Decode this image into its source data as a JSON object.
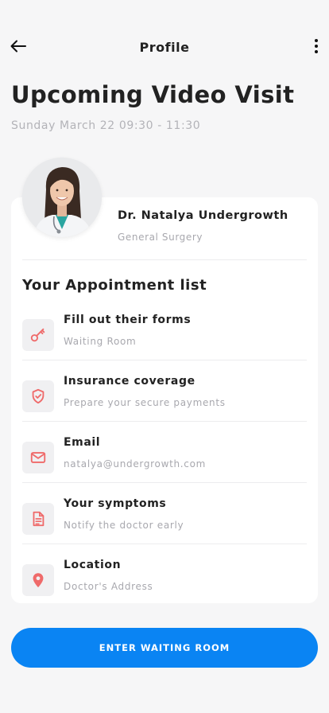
{
  "header": {
    "title": "Profile",
    "back_icon": "arrow-left-icon",
    "menu_icon": "more-vertical-icon"
  },
  "visit": {
    "title": "Upcoming Video Visit",
    "datetime": "Sunday March 22 09:30 - 11:30"
  },
  "doctor": {
    "name": "Dr. Natalya Undergrowth",
    "specialty": "General Surgery"
  },
  "appointment": {
    "section_title": "Your Appointment list",
    "items": [
      {
        "icon": "key-icon",
        "title": "Fill out their forms",
        "subtitle": "Waiting Room"
      },
      {
        "icon": "shield-check-icon",
        "title": "Insurance coverage",
        "subtitle": "Prepare your secure payments"
      },
      {
        "icon": "mail-icon",
        "title": "Email",
        "subtitle": "natalya@undergrowth.com"
      },
      {
        "icon": "document-icon",
        "title": "Your symptoms",
        "subtitle": "Notify the doctor early"
      },
      {
        "icon": "location-pin-icon",
        "title": "Location",
        "subtitle": "Doctor's Address"
      }
    ]
  },
  "cta": {
    "label": "ENTER WAITING ROOM"
  },
  "colors": {
    "accent": "#0a84f3",
    "icon": "#ef6a6a",
    "background": "#f6f6f7",
    "muted_text": "#a8a8ae"
  }
}
